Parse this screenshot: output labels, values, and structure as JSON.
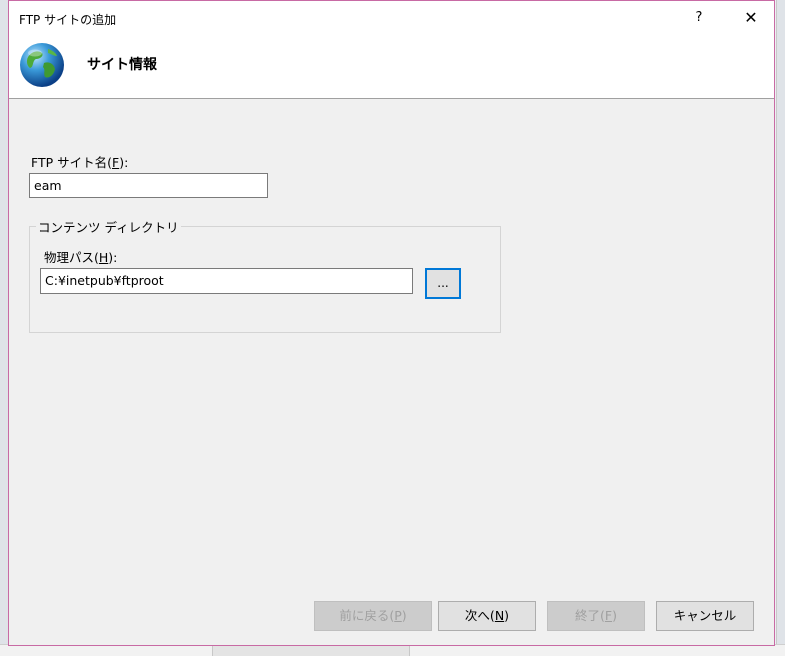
{
  "window": {
    "title": "FTP サイトの追加",
    "help_label": "?",
    "close_label": "✕"
  },
  "header": {
    "title": "サイト情報",
    "icon": "globe-icon"
  },
  "site_name": {
    "label_prefix": "FTP サイト名(",
    "label_key": "F",
    "label_suffix": "):",
    "value": "eam"
  },
  "content_dir": {
    "legend": "コンテンツ ディレクトリ",
    "path_label_prefix": "物理パス(",
    "path_label_key": "H",
    "path_label_suffix": "):",
    "path_value": "C:¥inetpub¥ftproot",
    "browse_label": "..."
  },
  "buttons": {
    "back": {
      "prefix": "前に戻る(",
      "key": "P",
      "suffix": ")"
    },
    "next": {
      "prefix": "次へ(",
      "key": "N",
      "suffix": ")"
    },
    "finish": {
      "prefix": "終了(",
      "key": "F",
      "suffix": ")"
    },
    "cancel": "キャンセル"
  },
  "colors": {
    "accent": "#0078d7",
    "dialog_border": "#c86aa4"
  }
}
